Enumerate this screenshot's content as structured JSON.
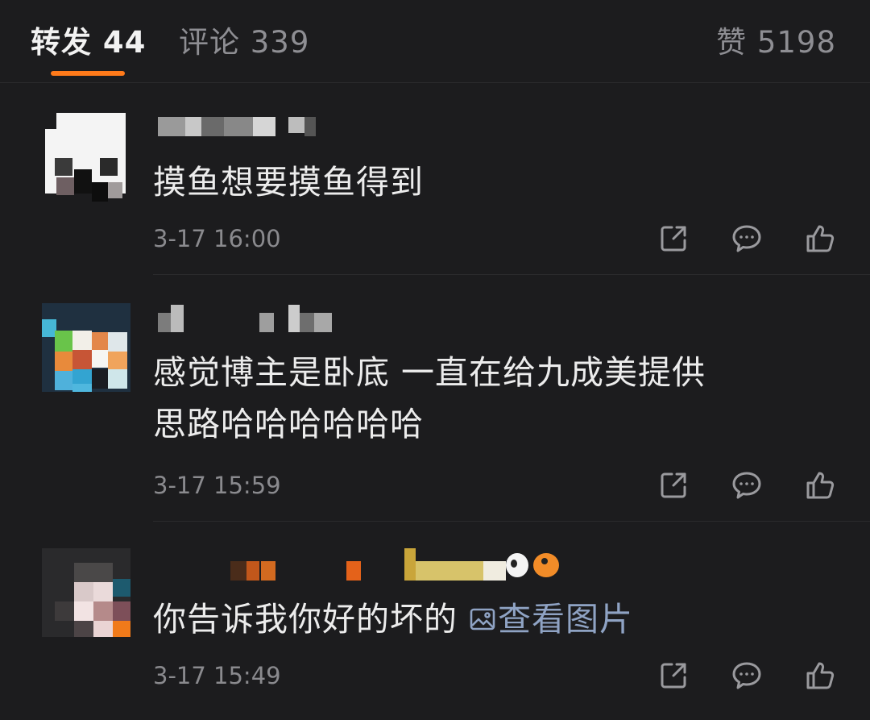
{
  "tabs": {
    "repost": "转发 44",
    "comment": "评论 339",
    "like": "赞 5198",
    "active_color": "#ff7a1a"
  },
  "comments": [
    {
      "text": "摸鱼想要摸鱼得到",
      "time": "3-17 16:00"
    },
    {
      "text_line1": "感觉博主是卧底 一直在给九成美提供",
      "text_line2": "思路哈哈哈哈哈哈",
      "time": "3-17 15:59"
    },
    {
      "text": "你告诉我你好的坏的",
      "image_link": "查看图片",
      "time": "3-17 15:49"
    }
  ],
  "icons": {
    "share": "share-icon",
    "reply": "comment-bubble-icon",
    "like": "thumbs-up-icon",
    "image": "image-icon"
  }
}
